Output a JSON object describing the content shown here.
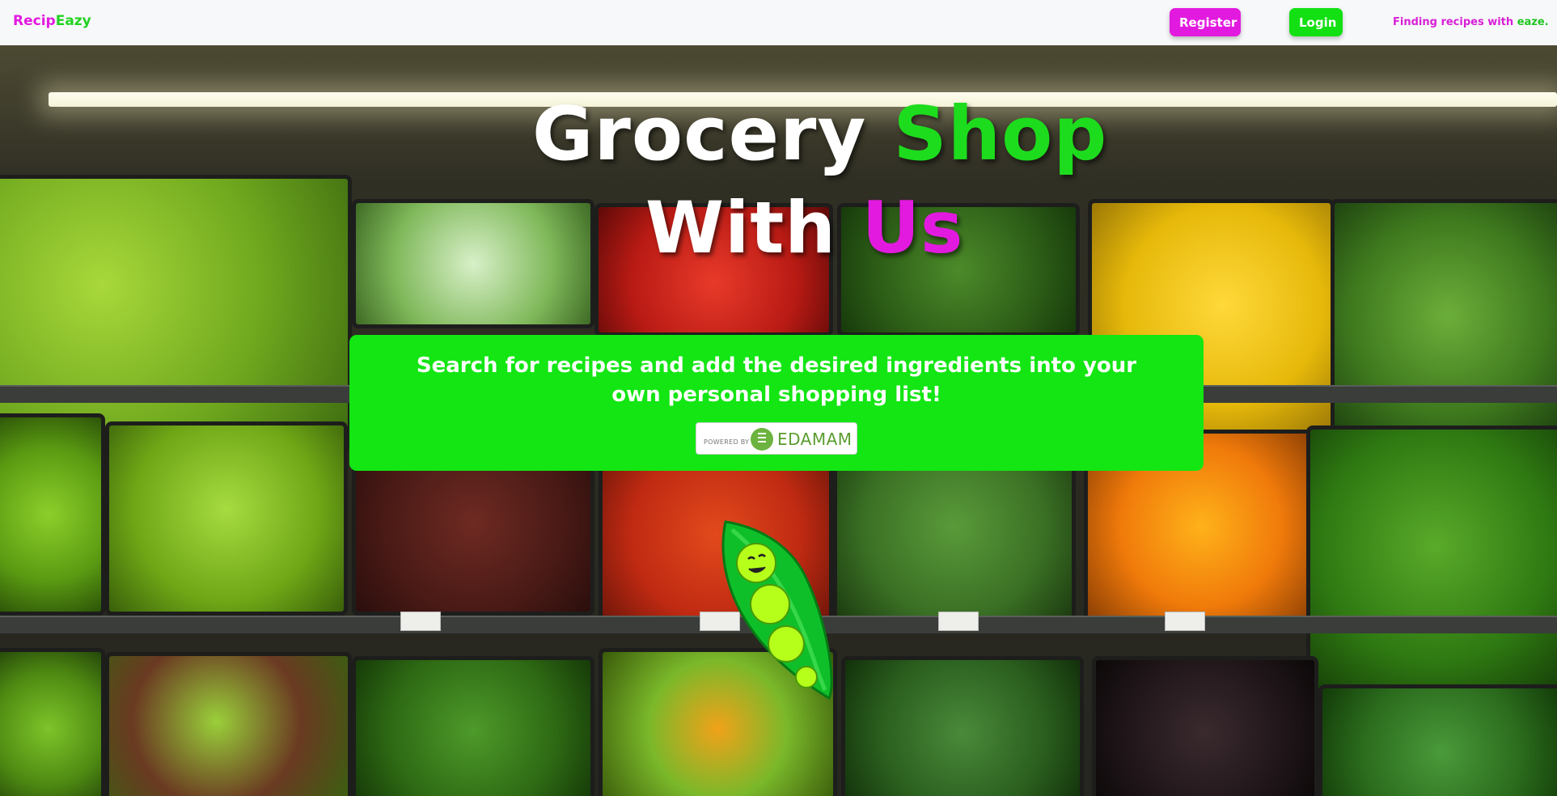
{
  "navbar": {
    "brand_part1": "Recip",
    "brand_part2": "Eazy",
    "register_label": "Register",
    "login_label": "Login",
    "tagline_main": "Finding recipes with ",
    "tagline_accent": "eaze."
  },
  "hero": {
    "headline_word1": "Grocery",
    "headline_word2": "Shop",
    "headline_word3": "With",
    "headline_word4": "Us",
    "card_text": "Search for recipes and add the desired ingredients into your own personal shopping list!",
    "badge_powered_by": "POWERED BY",
    "badge_brand": "EDAMAM"
  },
  "colors": {
    "brand_pink": "#e21adf",
    "brand_green": "#13e613",
    "navbar_bg": "#f7f8fa"
  },
  "icons": {
    "mascot": "pea-pod-mascot-icon",
    "badge_logo": "edamam-logo-icon"
  }
}
